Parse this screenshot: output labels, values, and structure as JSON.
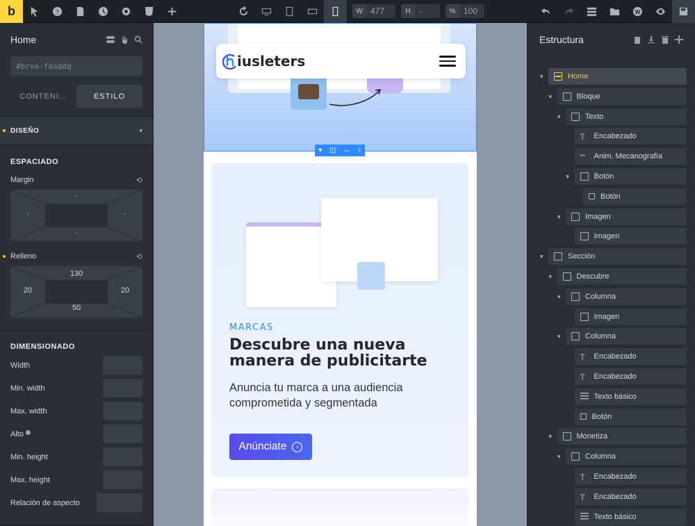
{
  "app": {
    "logo_letter": "b",
    "accent": "#ffd53e"
  },
  "toolbar": {
    "width_label": "W",
    "width_value": "477",
    "height_label": "H",
    "height_value": "-",
    "percent_label": "%",
    "percent_value": "100",
    "left_icons": [
      "pointer-icon",
      "help-icon",
      "page-icon",
      "history-icon",
      "settings-icon",
      "html5-icon",
      "add-icon"
    ],
    "breakpoint_icons": [
      "reload-icon",
      "desktop-icon",
      "tablet-portrait-icon",
      "tablet-landscape-icon",
      "mobile-icon"
    ],
    "right_icons": [
      "undo-icon",
      "redo-icon",
      "structure-icon",
      "folder-icon",
      "wordpress-icon",
      "preview-icon",
      "save-icon"
    ]
  },
  "left_panel": {
    "title": "Home",
    "element_id": "#brxe-fdaddq",
    "tabs": [
      "CONTENI…",
      "ESTILO"
    ],
    "active_tab": "ESTILO",
    "section": "DISEÑO",
    "spacing": {
      "heading": "ESPACIADO",
      "margin_label": "Margin",
      "margin": {
        "top": "-",
        "right": "-",
        "bottom": "-",
        "left": "-"
      },
      "padding_label": "Relleno",
      "padding": {
        "top": "130",
        "right": "20",
        "bottom": "50",
        "left": "20"
      }
    },
    "dimensions": {
      "heading": "DIMENSIONADO",
      "rows": [
        "Width",
        "Min. width",
        "Max. width",
        "Alto",
        "Min. height",
        "Max. height",
        "Relación de aspecto"
      ]
    }
  },
  "right_panel": {
    "title": "Estructura",
    "tree": [
      {
        "label": "Home",
        "icon": "section-icon",
        "depth": 0,
        "active": true
      },
      {
        "label": "Bloque",
        "icon": "box-icon",
        "depth": 1
      },
      {
        "label": "Texto",
        "icon": "box-icon",
        "depth": 2
      },
      {
        "label": "Encabezado",
        "icon": "heading-icon",
        "depth": 3
      },
      {
        "label": "Anim. Mecanografía",
        "icon": "typing-icon",
        "depth": 3
      },
      {
        "label": "Botón",
        "icon": "box-icon",
        "depth": 3
      },
      {
        "label": "Botón",
        "icon": "button-icon",
        "depth": 4
      },
      {
        "label": "Imagen",
        "icon": "box-icon",
        "depth": 2
      },
      {
        "label": "Imagen",
        "icon": "image-icon",
        "depth": 3
      },
      {
        "label": "Sección",
        "icon": "section-icon",
        "depth": 0
      },
      {
        "label": "Descubre",
        "icon": "box-icon",
        "depth": 1
      },
      {
        "label": "Columna",
        "icon": "box-icon",
        "depth": 2
      },
      {
        "label": "Imagen",
        "icon": "image-icon",
        "depth": 3
      },
      {
        "label": "Columna",
        "icon": "box-icon",
        "depth": 2
      },
      {
        "label": "Encabezado",
        "icon": "heading-icon",
        "depth": 3
      },
      {
        "label": "Encabezado",
        "icon": "heading-icon",
        "depth": 3
      },
      {
        "label": "Texto básico",
        "icon": "text-icon",
        "depth": 3
      },
      {
        "label": "Botón",
        "icon": "button-icon",
        "depth": 3
      },
      {
        "label": "Monetiza",
        "icon": "box-icon",
        "depth": 1
      },
      {
        "label": "Columna",
        "icon": "box-icon",
        "depth": 2
      },
      {
        "label": "Encabezado",
        "icon": "heading-icon",
        "depth": 3
      },
      {
        "label": "Encabezado",
        "icon": "heading-icon",
        "depth": 3
      },
      {
        "label": "Texto básico",
        "icon": "text-icon",
        "depth": 3
      }
    ]
  },
  "preview": {
    "brand": "iusleters",
    "eyebrow": "MARCAS",
    "heading": "Descubre una nueva manera de publicitarte",
    "body": "Anuncia tu marca a una audiencia comprometida y segmentada",
    "cta": "Anúnciate",
    "colors": {
      "eyebrow": "#2f8ee8",
      "cta": "#5b4ae8",
      "selection": "#2f8bff"
    }
  }
}
